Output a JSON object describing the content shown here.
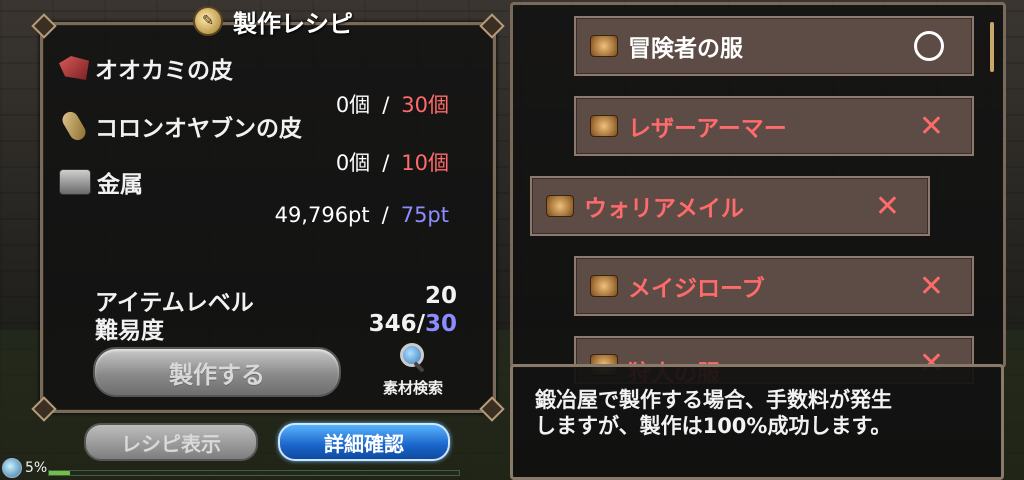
{
  "panel": {
    "title": "製作レシピ",
    "materials": [
      {
        "name": "オオカミの皮",
        "have": "0個",
        "need": "30個",
        "need_color": "#ff6b6b",
        "icon": "wolf-hide-icon"
      },
      {
        "name": "コロンオヤブンの皮",
        "have": "0個",
        "need": "10個",
        "need_color": "#ff6b6b",
        "icon": "colon-boss-hide-icon"
      },
      {
        "name": "金属",
        "have": "49,796pt",
        "need": "75pt",
        "need_color": "#8c8cff",
        "icon": "metal-ingot-icon"
      }
    ],
    "separator": "/",
    "item_level_label": "アイテムレベル",
    "item_level_value": "20",
    "difficulty_label": "難易度",
    "difficulty_have": "346/",
    "difficulty_need": "30",
    "craft_button": "製作する",
    "search_label": "素材検索"
  },
  "bottom": {
    "recipe_button": "レシピ表示",
    "detail_button": "詳細確認",
    "status_percent": "5%",
    "status_progress": 0.05
  },
  "list": {
    "items": [
      {
        "name": "冒険者の服",
        "status": "ok",
        "name_color": "#ffffff"
      },
      {
        "name": "レザーアーマー",
        "status": "x",
        "name_color": "#ff6b6b"
      },
      {
        "name": "ウォリアメイル",
        "status": "x",
        "name_color": "#ff6b6b"
      },
      {
        "name": "メイジローブ",
        "status": "x",
        "name_color": "#ff6b6b"
      },
      {
        "name": "狩人の服",
        "status": "x",
        "name_color": "#ff6b6b"
      }
    ],
    "x_mark": "✕"
  },
  "message": {
    "text": "鍛冶屋で製作する場合、手数料が発生\nしますが、製作は100%成功します。"
  },
  "colors": {
    "red": "#ff6b6b",
    "blue": "#8c8cff",
    "detail_button": "#1a64c9"
  }
}
